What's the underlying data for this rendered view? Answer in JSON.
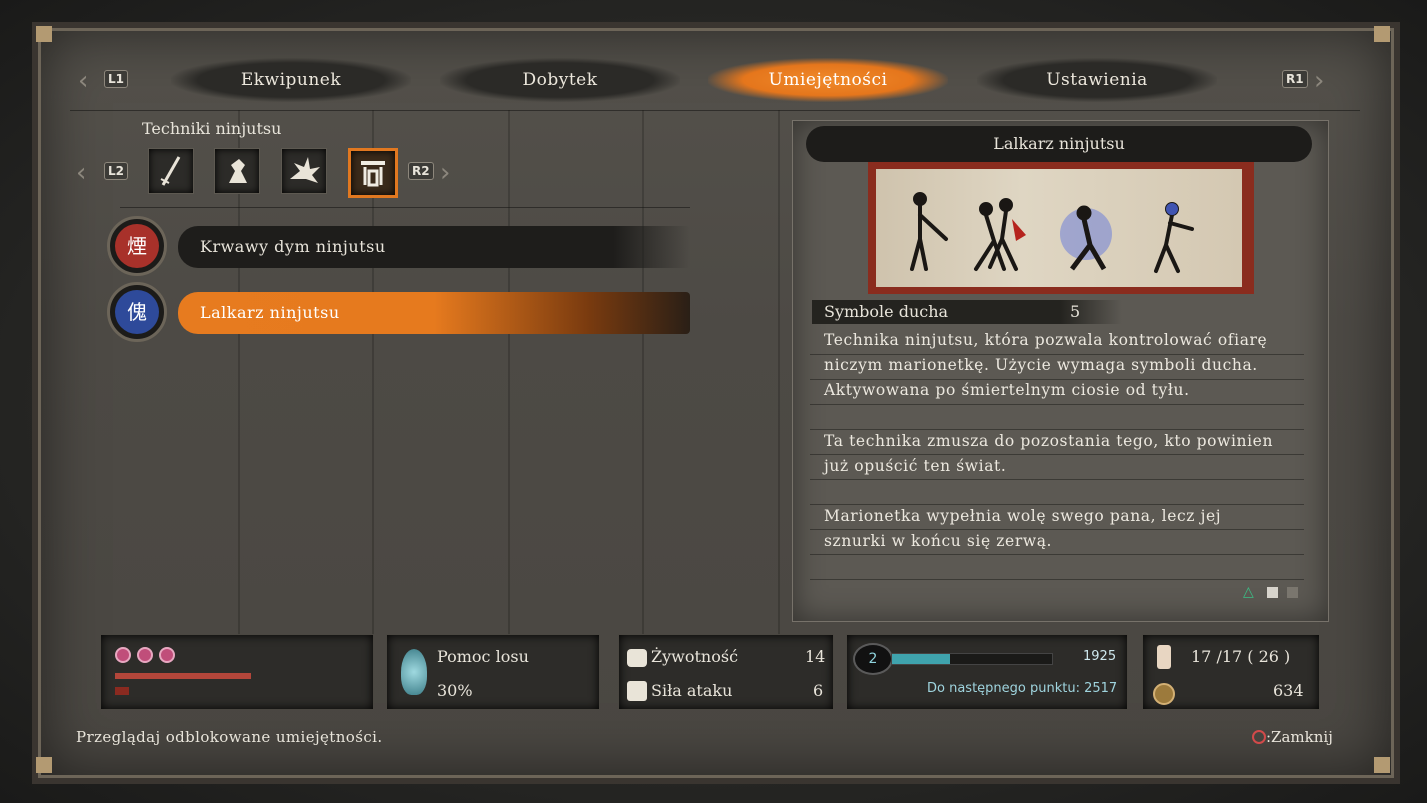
{
  "tabs": {
    "prev_btn": "L1",
    "next_btn": "R1",
    "items": [
      "Ekwipunek",
      "Dobytek",
      "Umiejętności",
      "Ustawienia"
    ],
    "active_index": 2
  },
  "category": {
    "title": "Techniki ninjutsu",
    "prev_btn": "L2",
    "next_btn": "R2",
    "tools": [
      "sword-icon",
      "warrior-icon",
      "burst-icon",
      "puppet-icon"
    ],
    "selected_tool": 3
  },
  "skills": [
    {
      "name": "Krwawy dym ninjutsu",
      "glyph": "煙",
      "icon_color": "#a8312a",
      "selected": false
    },
    {
      "name": "Lalkarz ninjutsu",
      "glyph": "傀",
      "icon_color": "#2e4a9a",
      "selected": true
    }
  ],
  "detail": {
    "title": "Lalkarz ninjutsu",
    "cost_label": "Symbole ducha",
    "cost_value": "5",
    "paragraph1": [
      "Technika ninjutsu, która pozwala kontrolować ofiarę",
      "niczym marionetkę. Użycie wymaga symboli ducha.",
      "Aktywowana po śmiertelnym ciosie od tyłu."
    ],
    "paragraph2": [
      "Ta technika zmusza do pozostania tego, kto powinien",
      "już opuścić ten świat."
    ],
    "paragraph3": [
      "Marionetka wypełnia wolę swego pana, lecz jej",
      "sznurki w końcu się zerwą."
    ]
  },
  "status": {
    "resurrection_nodes": 3,
    "luck_label": "Pomoc losu",
    "luck_value": "30%",
    "vitality_label": "Żywotność",
    "vitality_value": "14",
    "attack_label": "Siła ataku",
    "attack_value": "6",
    "skill_points": "2",
    "xp_value": "1925",
    "xp_progress": 0.36,
    "next_point_label": "Do następnego punktu: 2517",
    "emblems": "17 /17  ( 26 )",
    "sen": "634"
  },
  "footer": {
    "hint": "Przeglądaj odblokowane umiejętności.",
    "close_label": ":Zamknij"
  },
  "colors": {
    "accent": "#e5761c",
    "xp_bar": "#3fa3ad",
    "health": "#b3463a"
  }
}
